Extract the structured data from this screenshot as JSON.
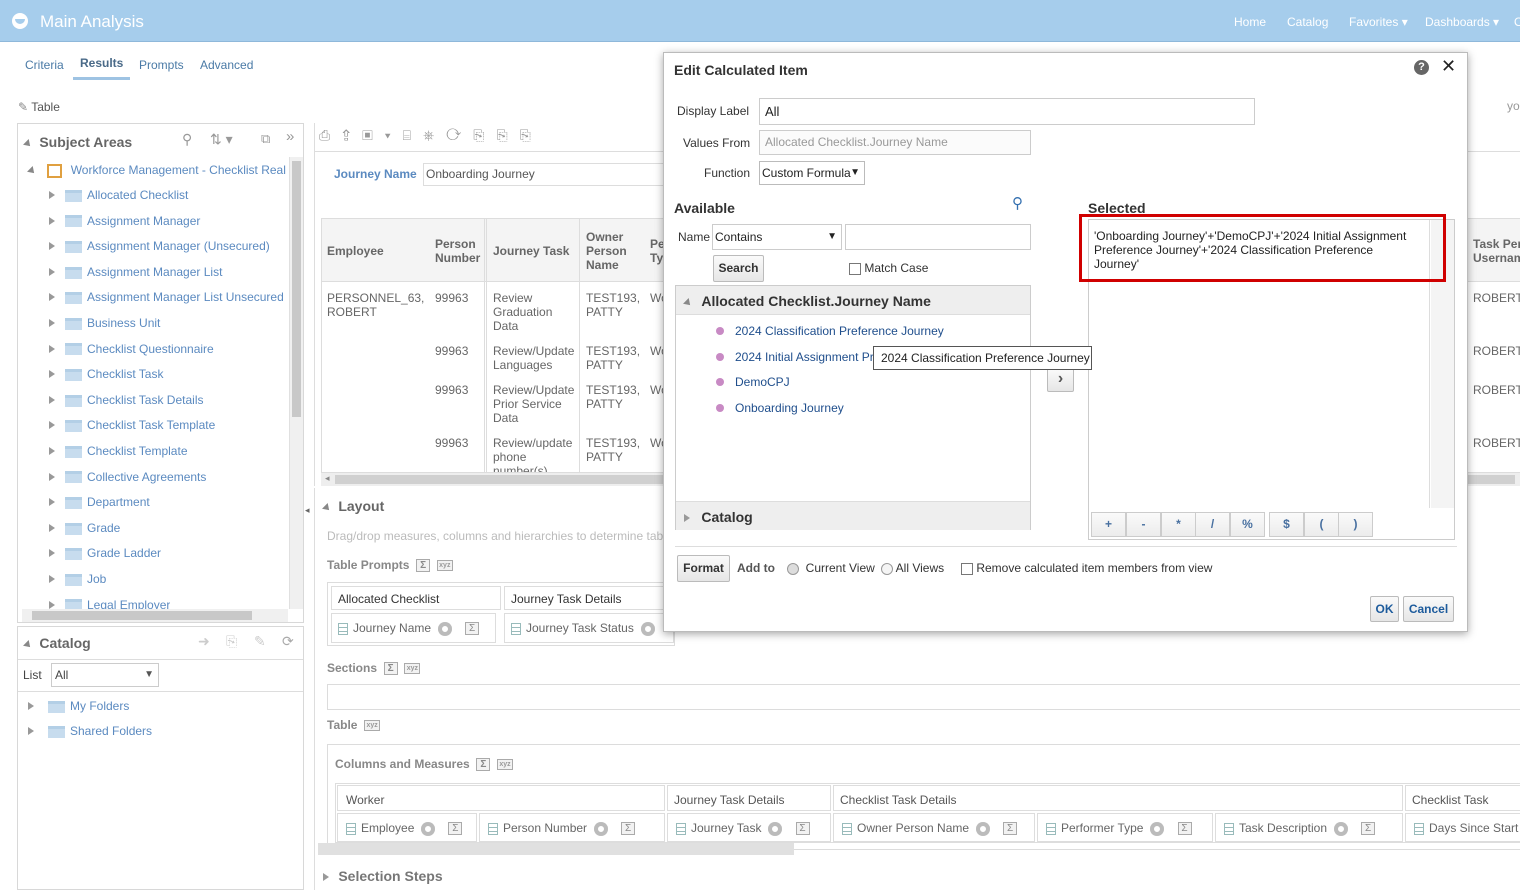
{
  "header": {
    "title": "Main Analysis",
    "nav": [
      "Home",
      "Catalog",
      "Favorites",
      "Dashboards",
      "O"
    ]
  },
  "tabs": [
    "Criteria",
    "Results",
    "Prompts",
    "Advanced"
  ],
  "toolbar": {
    "table_label": "Table"
  },
  "subject_areas": {
    "title": "Subject Areas",
    "root": "Workforce Management - Checklist Real",
    "items": [
      "Allocated Checklist",
      "Assignment Manager",
      "Assignment Manager (Unsecured)",
      "Assignment Manager List",
      "Assignment Manager List Unsecured",
      "Business Unit",
      "Checklist Questionnaire",
      "Checklist Task",
      "Checklist Task Details",
      "Checklist Task Template",
      "Checklist Template",
      "Collective Agreements",
      "Department",
      "Grade",
      "Grade Ladder",
      "Job",
      "Legal Employer"
    ]
  },
  "catalog_panel": {
    "title": "Catalog",
    "list_label": "List",
    "list_value": "All",
    "items": [
      "My Folders",
      "Shared Folders"
    ]
  },
  "results": {
    "prompt_label": "Journey Name",
    "prompt_value": "Onboarding Journey",
    "columns": [
      "Employee",
      "Person Number",
      "Journey Task",
      "Owner Person Name",
      "Pe Ty"
    ],
    "right_column": "Task Per Usernam",
    "employee": "PERSONNEL_63, ROBERT",
    "rows": [
      {
        "number": "99963",
        "task": "Review Graduation Data",
        "owner": "TEST193, PATTY",
        "type": "Wo",
        "user": "ROBERT"
      },
      {
        "number": "99963",
        "task": "Review/Update Languages",
        "owner": "TEST193, PATTY",
        "type": "Wo",
        "user": "ROBERT"
      },
      {
        "number": "99963",
        "task": "Review/Update Prior Service Data",
        "owner": "TEST193, PATTY",
        "type": "Wo",
        "user": "ROBERT"
      },
      {
        "number": "99963",
        "task": "Review/update phone number(s)",
        "owner": "TEST193, PATTY",
        "type": "Wo",
        "user": "ROBERT"
      }
    ],
    "right_hint": "yout\""
  },
  "layout": {
    "title": "Layout",
    "hint": "Drag/drop measures, columns and hierarchies to determine tab",
    "table_prompts": "Table Prompts",
    "tp_groups": [
      {
        "header": "Allocated Checklist",
        "item": "Journey Name"
      },
      {
        "header": "Journey Task Details",
        "item": "Journey Task Status"
      }
    ],
    "sections": "Sections",
    "table": "Table",
    "columns_measures": "Columns and Measures",
    "cm_groups": [
      {
        "header": "Worker",
        "items": [
          "Employee",
          "Person Number"
        ]
      },
      {
        "header": "Journey Task Details",
        "items": [
          "Journey Task"
        ]
      },
      {
        "header": "Checklist Task Details",
        "items": [
          "Owner Person Name",
          "Performer Type",
          "Task Description"
        ]
      },
      {
        "header": "Checklist Task",
        "items": [
          "Days Since Start"
        ]
      }
    ],
    "selection_steps": "Selection Steps"
  },
  "dialog": {
    "title": "Edit Calculated Item",
    "display_label": "Display Label",
    "display_value": "All",
    "values_from": "Values From",
    "values_from_value": "Allocated Checklist.Journey Name",
    "function_label": "Function",
    "function_value": "Custom Formula",
    "available": "Available",
    "name_label": "Name",
    "name_op": "Contains",
    "search_btn": "Search",
    "match_case": "Match Case",
    "group_title": "Allocated Checklist.Journey Name",
    "values": [
      "2024 Classification Preference Journey",
      "2024 Initial Assignment Pr",
      "DemoCPJ",
      "Onboarding Journey"
    ],
    "tooltip": "2024 Classification Preference Journey",
    "catalog": "Catalog",
    "selected": "Selected",
    "formula": "'Onboarding Journey'+'DemoCPJ'+'2024 Initial Assignment Preference Journey'+'2024 Classification Preference Journey'",
    "operators": [
      "+",
      "-",
      "*",
      "/",
      "%",
      "$",
      "(",
      ")"
    ],
    "format_btn": "Format",
    "add_to": "Add to",
    "current_view": "Current View",
    "all_views": "All Views",
    "remove_label": "Remove calculated item members from view",
    "ok": "OK",
    "cancel": "Cancel"
  },
  "colors": {
    "header_bg": "#a6cdec",
    "highlight": "#d00000",
    "link": "#1d5b9c"
  }
}
